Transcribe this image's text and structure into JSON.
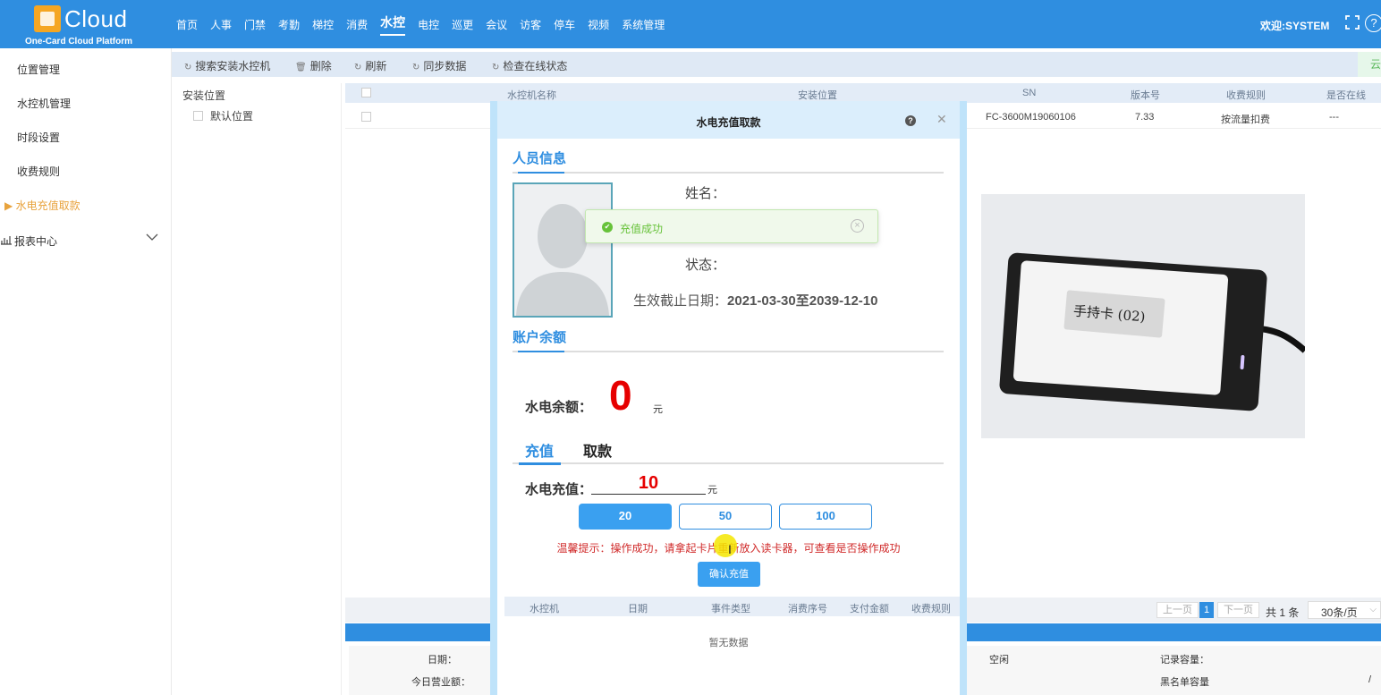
{
  "header": {
    "brand": "Cloud",
    "subtitle": "One-Card Cloud Platform",
    "nav": [
      "首页",
      "人事",
      "门禁",
      "考勤",
      "梯控",
      "消费",
      "水控",
      "电控",
      "巡更",
      "会议",
      "访客",
      "停车",
      "视频",
      "系统管理"
    ],
    "active_nav": "水控",
    "welcome": "欢迎:SYSTEM",
    "fullscreen_icon": "fullscreen-icon",
    "help_icon": "help-icon",
    "help_glyph": "?"
  },
  "sidebar": {
    "items": [
      "位置管理",
      "水控机管理",
      "时段设置",
      "收费规则",
      "水电充值取款",
      "报表中心"
    ],
    "active": "水电充值取款"
  },
  "toolbar": {
    "buttons": [
      "搜索安装水控机",
      "删除",
      "刷新",
      "同步数据",
      "检查在线状态"
    ],
    "cloud_btn": "云"
  },
  "tree": {
    "header": "安装位置",
    "items": [
      "默认位置"
    ]
  },
  "table": {
    "columns": [
      "水控机名称",
      "安装位置",
      "SN",
      "版本号",
      "收费规则",
      "是否在线"
    ],
    "rows": [
      {
        "name": "",
        "location": "",
        "sn": "FC-3600M19060106",
        "version": "7.33",
        "rule": "按流量扣费",
        "online": "---"
      }
    ]
  },
  "card_image": {
    "label": "手持卡 (02)"
  },
  "pager": {
    "prev": "上一页",
    "current": "1",
    "next": "下一页",
    "total": "共 1 条",
    "page_size": "30条/页"
  },
  "info": {
    "date_label": "日期：",
    "revenue_label": "今日营业额：",
    "status_value": "空闲",
    "record_capacity_label": "记录容量：",
    "blacklist_capacity_label": "黑名单容量",
    "blacklist_value": "/"
  },
  "modal": {
    "title": "水电充值取款",
    "person_section": "人员信息",
    "name_label": "姓名：",
    "status_label": "状态：",
    "expiry_label": "生效截止日期：",
    "expiry_value": "2021-03-30至2039-12-10",
    "balance_section": "账户余额",
    "balance_label": "水电余额：",
    "balance_value": "0",
    "balance_unit": "元",
    "tabs": [
      "充值",
      "取款"
    ],
    "active_tab": "充值",
    "charge_label": "水电充值：",
    "charge_value": "10",
    "charge_unit": "元",
    "amounts": [
      "20",
      "50",
      "100"
    ],
    "selected_amount": "20",
    "tip": "温馨提示：操作成功，请拿起卡片重新放入读卡器，可查看是否操作成功",
    "confirm": "确认充值",
    "history_columns": [
      "水控机",
      "日期",
      "事件类型",
      "消费序号",
      "支付金额",
      "收费规则"
    ],
    "no_data": "暂无数据"
  },
  "toast": {
    "message": "充值成功",
    "type": "success"
  },
  "colors": {
    "primary": "#2f8ee0",
    "danger": "#e60000",
    "active_sidebar": "#e8a33d",
    "success": "#67c23a"
  }
}
